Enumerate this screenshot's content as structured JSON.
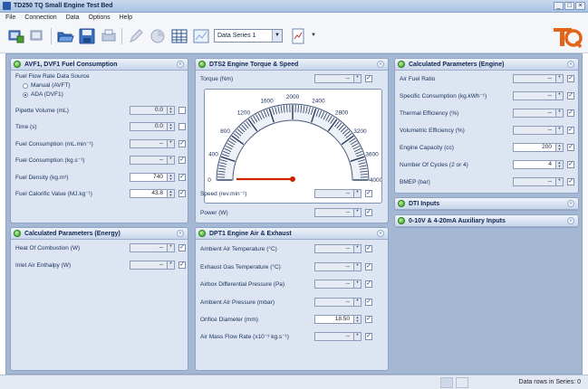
{
  "window": {
    "title": "TD250 TQ Small Engine Test Bed",
    "minimize": "_",
    "maximize": "□",
    "close": "×"
  },
  "menu": [
    "File",
    "Connection",
    "Data",
    "Options",
    "Help"
  ],
  "toolbar": {
    "series_value": "Data Series 1",
    "logo_text": "TQ"
  },
  "panels": {
    "fuel": {
      "title": "AVF1, DVF1 Fuel Consumption",
      "source_label": "Fuel Flow Rate Data Source",
      "radio_manual": "Manual (AVFT)",
      "radio_ada": "ADA (DVF1)",
      "rows": [
        {
          "label": "Pipette Volume (mL)",
          "value": "0.0"
        },
        {
          "label": "Time (s)",
          "value": "0.0"
        },
        {
          "label": "Fuel Consumption (mL.min⁻¹)",
          "value": "--"
        },
        {
          "label": "Fuel Consumption (kg.s⁻¹)",
          "value": "--"
        },
        {
          "label": "Fuel Density (kg.m³)",
          "value": "740"
        },
        {
          "label": "Fuel Calorific Value (MJ.kg⁻¹)",
          "value": "43.8"
        }
      ]
    },
    "energy": {
      "title": "Calculated Parameters (Energy)",
      "rows": [
        {
          "label": "Heat Of Combustion (W)",
          "value": "--"
        },
        {
          "label": "Inlet Air Enthalpy (W)",
          "value": "--"
        }
      ]
    },
    "torque": {
      "title": "DTS2 Engine Torque & Speed",
      "torque_label": "Torque (Nm)",
      "torque_value": "--",
      "speed_label": "Speed (rev.min⁻¹)",
      "speed_value": "--",
      "power_label": "Power (W)",
      "power_value": "--",
      "gauge": {
        "ticks": [
          "0",
          "400",
          "800",
          "1200",
          "1600",
          "2000",
          "2400",
          "2800",
          "3200",
          "3600",
          "4000"
        ],
        "value": 0,
        "max": 4000
      }
    },
    "air": {
      "title": "DPT1 Engine Air & Exhaust",
      "rows": [
        {
          "label": "Ambient Air Temperature (°C)",
          "value": "--"
        },
        {
          "label": "Exhaust Gas Temperature (°C)",
          "value": "--"
        },
        {
          "label": "Airbox Differential Pressure (Pa)",
          "value": "--"
        },
        {
          "label": "Ambient Air Pressure (mbar)",
          "value": "--"
        },
        {
          "label": "Orifice Diameter (mm)",
          "value": "18.50"
        },
        {
          "label": "Air Mass Flow Rate (x10⁻³ kg.s⁻¹)",
          "value": "--"
        }
      ]
    },
    "engine": {
      "title": "Calculated Parameters (Engine)",
      "rows": [
        {
          "label": "Air Fuel Ratio",
          "value": "--"
        },
        {
          "label": "Specific Consumption (kg.kWh⁻¹)",
          "value": "--"
        },
        {
          "label": "Thermal Efficiency (%)",
          "value": "--"
        },
        {
          "label": "Volumetric Efficiency (%)",
          "value": "--"
        },
        {
          "label": "Engine Capacity (cc)",
          "value": "200"
        },
        {
          "label": "Number Of Cycles (2 or 4)",
          "value": "4"
        },
        {
          "label": "BMEP (bar)",
          "value": "--"
        }
      ]
    },
    "dti": {
      "title": "DTI Inputs"
    },
    "aux": {
      "title": "0-10V & 4-20mA Auxiliary Inputs"
    }
  },
  "status": {
    "text": "Data rows in Series: 0"
  },
  "colors": {
    "accent": "#2f9a1f",
    "needle": "#cc2200",
    "workspace": "#a5b8d3"
  }
}
